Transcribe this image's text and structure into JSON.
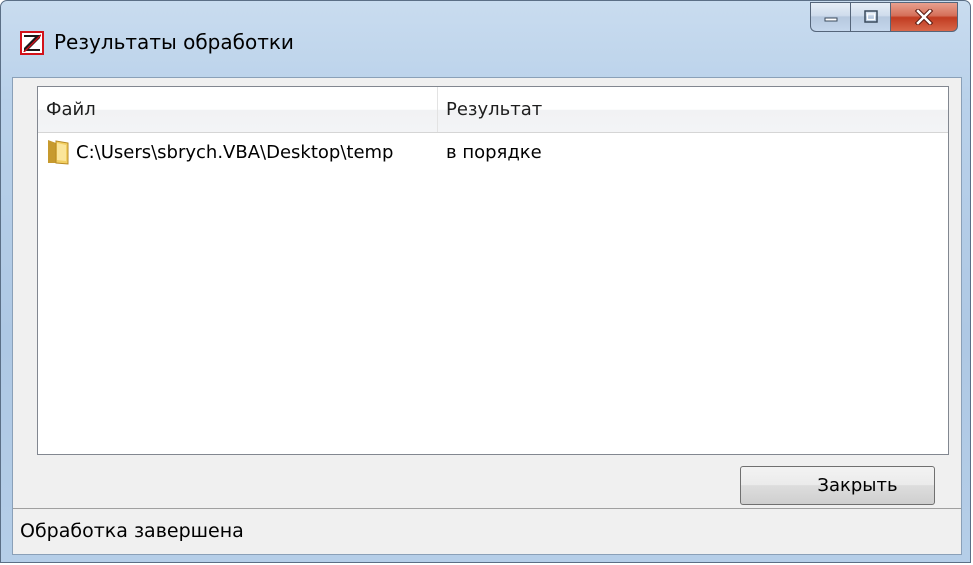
{
  "window": {
    "title": "Результаты обработки",
    "app_icon": "app-logo-icon",
    "caption_buttons": [
      "minimize-icon",
      "maximize-icon",
      "close-icon"
    ]
  },
  "list": {
    "columns": [
      "Файл",
      "Результат"
    ],
    "rows": [
      {
        "file": "C:\\Users\\sbrych.VBA\\Desktop\\temp",
        "result": "в порядке",
        "icon": "folder-icon"
      }
    ]
  },
  "buttons": {
    "close_label": "Закрыть"
  },
  "status": {
    "text": "Обработка завершена"
  },
  "colors": {
    "titlebar": "#b9d1ea",
    "close_caption": "#c13c21",
    "client_bg": "#f0f0f0"
  }
}
